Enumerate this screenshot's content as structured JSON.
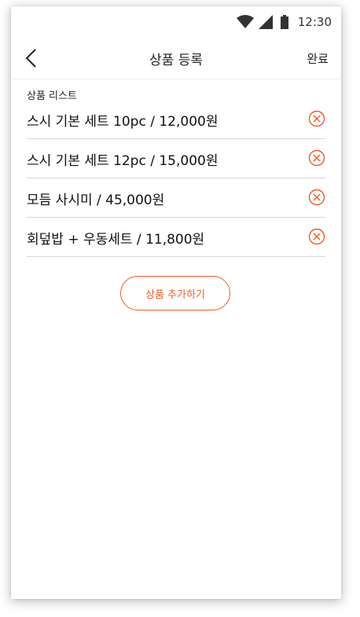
{
  "status_bar": {
    "time": "12:30",
    "icons": [
      "wifi-icon",
      "cell-signal-icon",
      "battery-icon"
    ]
  },
  "app_bar": {
    "back_icon": "chevron-left-icon",
    "title": "상품 등록",
    "done_label": "완료"
  },
  "section": {
    "label": "상품 리스트"
  },
  "products": [
    {
      "name": "스시 기본 세트 10pc / 12,000원"
    },
    {
      "name": "스시 기본 세트 12pc / 15,000원"
    },
    {
      "name": "모듬 사시미 / 45,000원"
    },
    {
      "name": "회덮밥 + 우동세트 / 11,800원"
    }
  ],
  "remove_icon": "circle-x-icon",
  "add_button": {
    "label": "상품 추가하기"
  },
  "colors": {
    "accent": "#f15a24",
    "divider": "#d8d8d8",
    "text": "#111111"
  }
}
